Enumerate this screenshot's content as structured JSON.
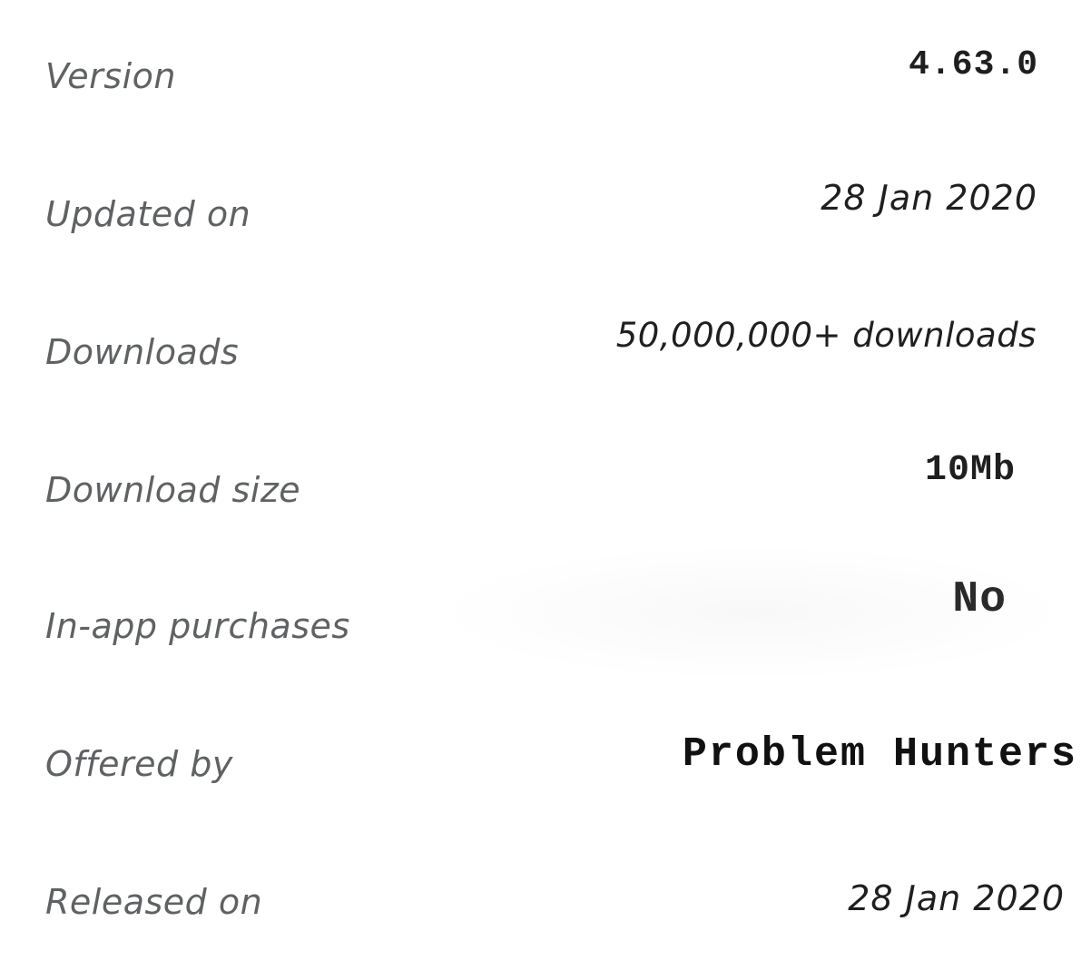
{
  "app_details": {
    "version": {
      "label": "Version",
      "value": "4.63.0"
    },
    "updated_on": {
      "label": "Updated on",
      "value": "28 Jan 2020"
    },
    "downloads": {
      "label": "Downloads",
      "value": "50,000,000+ downloads"
    },
    "download_size": {
      "label": "Download size",
      "value": "10Mb"
    },
    "in_app_purchases": {
      "label": "In-app purchases",
      "value": "No"
    },
    "offered_by": {
      "label": "Offered by",
      "value": "Problem Hunters"
    },
    "released_on": {
      "label": "Released on",
      "value": "28 Jan 2020"
    }
  },
  "colors": {
    "label": "#5f6163",
    "value": "#1f1f1f",
    "background": "#ffffff"
  }
}
